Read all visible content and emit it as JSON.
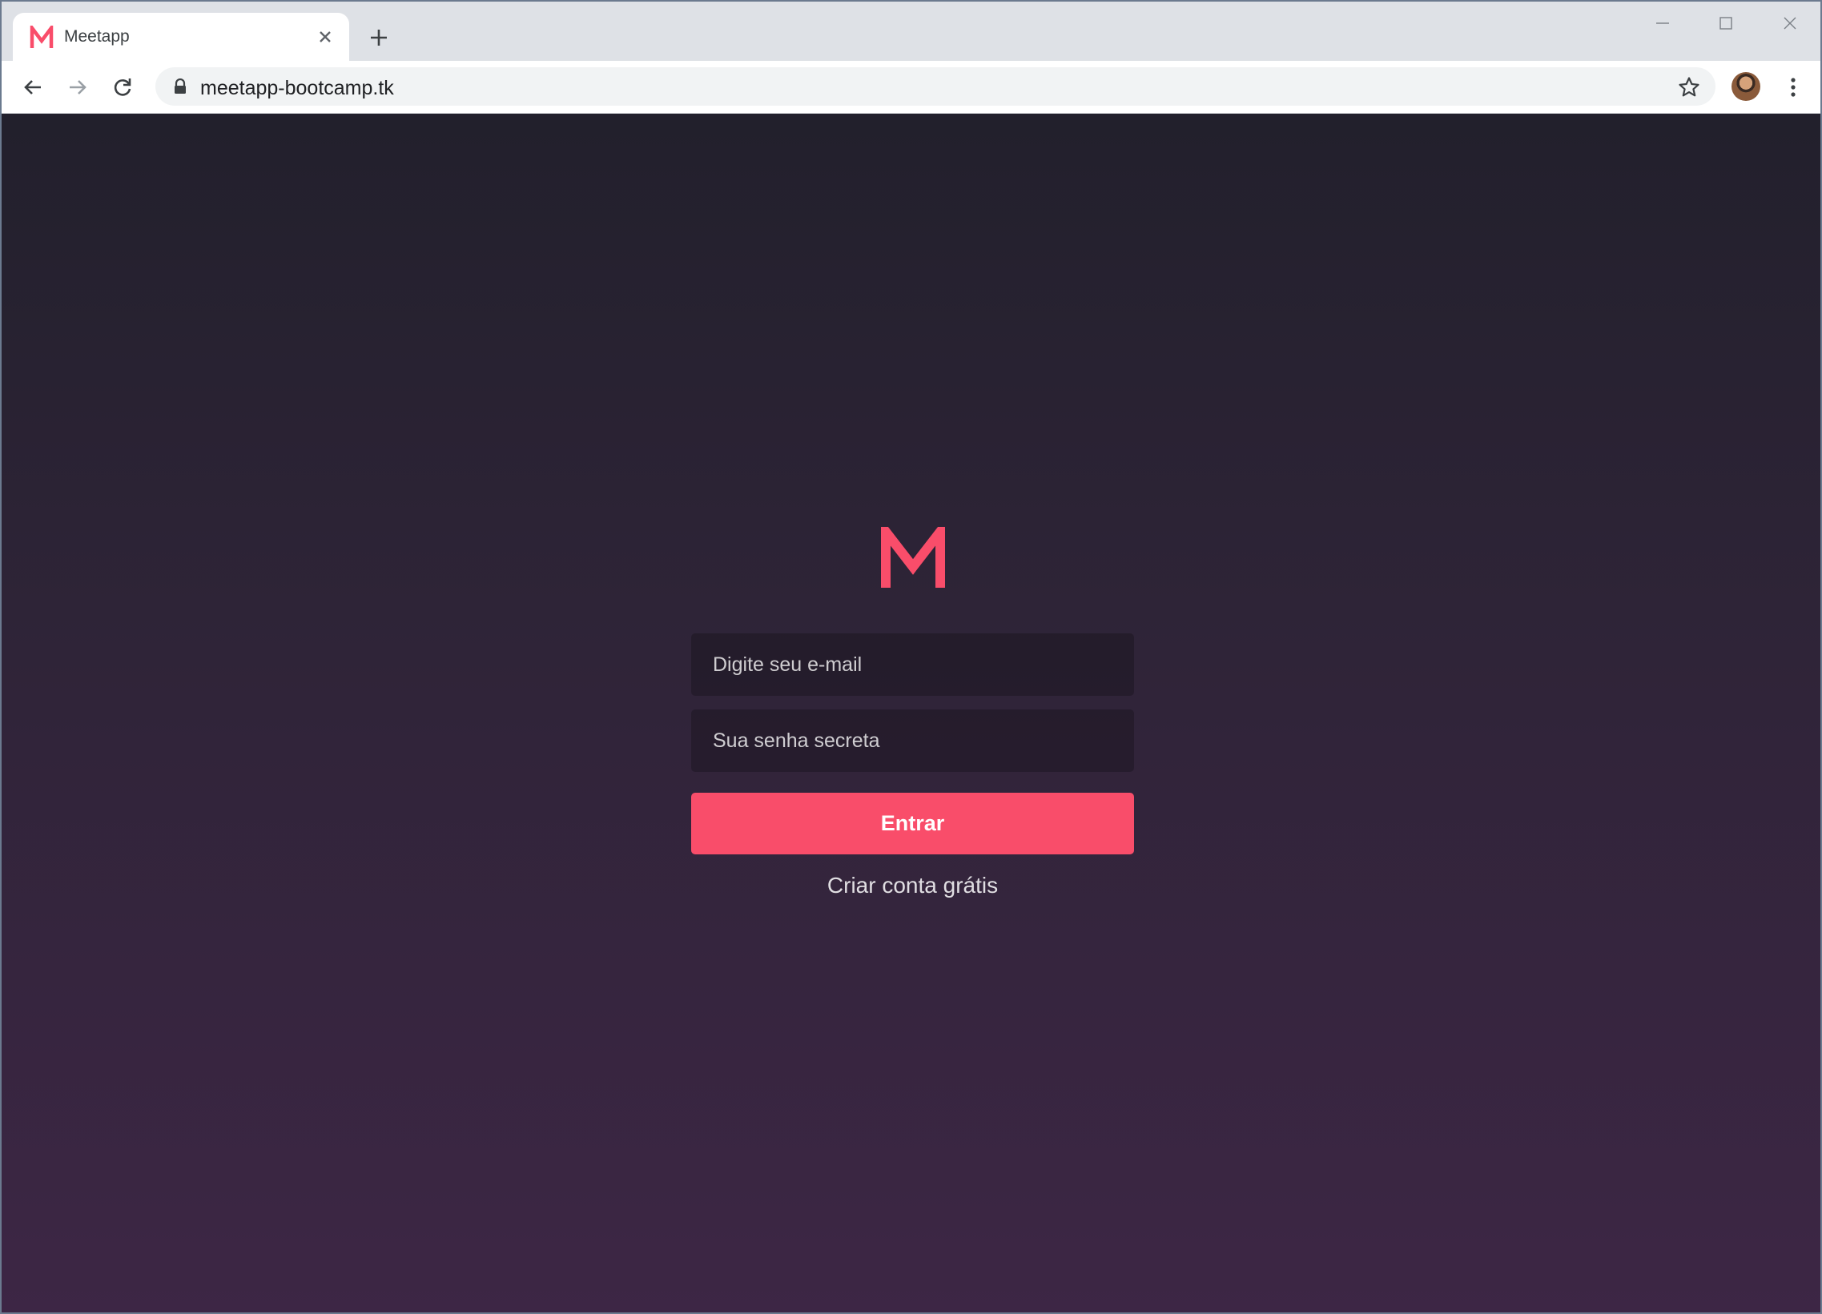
{
  "browser": {
    "tab": {
      "title": "Meetapp",
      "favicon": "meetapp-logo-icon"
    },
    "address_bar": {
      "url": "meetapp-bootcamp.tk"
    },
    "icons": [
      "back-icon",
      "forward-icon",
      "reload-icon",
      "lock-icon",
      "star-icon",
      "menu-icon",
      "close-icon",
      "new-tab-icon",
      "minimize-icon",
      "maximize-icon"
    ]
  },
  "login": {
    "email_placeholder": "Digite seu e-mail",
    "password_placeholder": "Sua senha secreta",
    "submit_label": "Entrar",
    "signup_link": "Criar conta grátis"
  },
  "colors": {
    "brand": "#f94d6a",
    "background_top": "#22202c",
    "background_bottom": "#3d2645"
  }
}
